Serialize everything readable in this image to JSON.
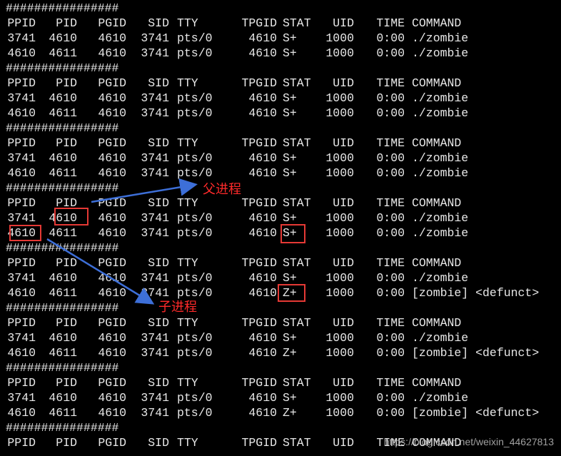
{
  "terminal": {
    "separator": "################",
    "headers": [
      "PPID",
      "PID",
      "PGID",
      "SID",
      "TTY",
      "TPGID",
      "STAT",
      "UID",
      "TIME",
      "COMMAND"
    ],
    "blocks": [
      {
        "rows": [
          [
            "3741",
            "4610",
            "4610",
            "3741",
            "pts/0",
            "4610",
            "S+",
            "1000",
            "0:00",
            "./zombie"
          ],
          [
            "4610",
            "4611",
            "4610",
            "3741",
            "pts/0",
            "4610",
            "S+",
            "1000",
            "0:00",
            "./zombie"
          ]
        ]
      },
      {
        "rows": [
          [
            "3741",
            "4610",
            "4610",
            "3741",
            "pts/0",
            "4610",
            "S+",
            "1000",
            "0:00",
            "./zombie"
          ],
          [
            "4610",
            "4611",
            "4610",
            "3741",
            "pts/0",
            "4610",
            "S+",
            "1000",
            "0:00",
            "./zombie"
          ]
        ]
      },
      {
        "rows": [
          [
            "3741",
            "4610",
            "4610",
            "3741",
            "pts/0",
            "4610",
            "S+",
            "1000",
            "0:00",
            "./zombie"
          ],
          [
            "4610",
            "4611",
            "4610",
            "3741",
            "pts/0",
            "4610",
            "S+",
            "1000",
            "0:00",
            "./zombie"
          ]
        ]
      },
      {
        "rows": [
          [
            "3741",
            "4610",
            "4610",
            "3741",
            "pts/0",
            "4610",
            "S+",
            "1000",
            "0:00",
            "./zombie"
          ],
          [
            "4610",
            "4611",
            "4610",
            "3741",
            "pts/0",
            "4610",
            "S+",
            "1000",
            "0:00",
            "./zombie"
          ]
        ]
      },
      {
        "rows": [
          [
            "3741",
            "4610",
            "4610",
            "3741",
            "pts/0",
            "4610",
            "S+",
            "1000",
            "0:00",
            "./zombie"
          ],
          [
            "4610",
            "4611",
            "4610",
            "3741",
            "pts/0",
            "4610",
            "Z+",
            "1000",
            "0:00",
            "[zombie] <defunct>"
          ]
        ]
      },
      {
        "rows": [
          [
            "3741",
            "4610",
            "4610",
            "3741",
            "pts/0",
            "4610",
            "S+",
            "1000",
            "0:00",
            "./zombie"
          ],
          [
            "4610",
            "4611",
            "4610",
            "3741",
            "pts/0",
            "4610",
            "Z+",
            "1000",
            "0:00",
            "[zombie] <defunct>"
          ]
        ]
      },
      {
        "rows": [
          [
            "3741",
            "4610",
            "4610",
            "3741",
            "pts/0",
            "4610",
            "S+",
            "1000",
            "0:00",
            "./zombie"
          ],
          [
            "4610",
            "4611",
            "4610",
            "3741",
            "pts/0",
            "4610",
            "Z+",
            "1000",
            "0:00",
            "[zombie] <defunct>"
          ]
        ]
      }
    ]
  },
  "annotations": {
    "parent_label": "父进程",
    "child_label": "子进程",
    "highlight_color": "#e53935",
    "arrow_color": "#3d6fd8"
  },
  "watermark": "https://blog.csdn.net/weixin_44627813"
}
